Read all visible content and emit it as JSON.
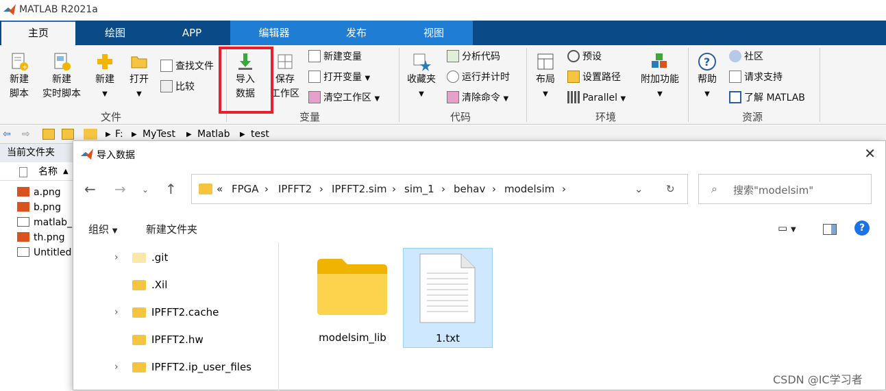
{
  "app": {
    "title": "MATLAB R2021a"
  },
  "tabs": [
    "主页",
    "绘图",
    "APP",
    "编辑器",
    "发布",
    "视图"
  ],
  "ribbon": {
    "file": {
      "new_script": "新建\n脚本",
      "new_live_script": "新建\n实时脚本",
      "new": "新建",
      "open": "打开",
      "find_files": "查找文件",
      "compare": "比较",
      "group_label": "文件"
    },
    "variable": {
      "import_data": "导入\n数据",
      "save_workspace": "保存\n工作区",
      "new_variable": "新建变量",
      "open_variable": "打开变量",
      "clear_workspace": "清空工作区",
      "group_label": "变量"
    },
    "code": {
      "favorites": "收藏夹",
      "analyze_code": "分析代码",
      "run_and_time": "运行并计时",
      "clear_commands": "清除命令",
      "group_label": "代码"
    },
    "environment": {
      "layout": "布局",
      "preferences": "预设",
      "set_path": "设置路径",
      "parallel": "Parallel",
      "addons": "附加功能",
      "group_label": "环境"
    },
    "resources": {
      "help": "帮助",
      "community": "社区",
      "request_support": "请求支持",
      "learn_matlab": "了解 MATLAB",
      "group_label": "资源"
    }
  },
  "path": [
    "F:",
    "MyTest",
    "Matlab",
    "test"
  ],
  "current_folder": {
    "title": "当前文件夹",
    "name_col": "名称",
    "files": [
      "a.png",
      "b.png",
      "matlab_",
      "th.png",
      "Untitled"
    ]
  },
  "dialog": {
    "title": "导入数据",
    "address": [
      "«",
      "FPGA",
      "IPFFT2",
      "IPFFT2.sim",
      "sim_1",
      "behav",
      "modelsim"
    ],
    "search_placeholder": "搜索\"modelsim\"",
    "organize": "组织",
    "new_folder": "新建文件夹",
    "tree": [
      ".git",
      ".Xil",
      "IPFFT2.cache",
      "IPFFT2.hw",
      "IPFFT2.ip_user_files"
    ],
    "files": [
      "modelsim_lib",
      "1.txt"
    ]
  },
  "watermark": "CSDN @IC学习者",
  "colors": {
    "tab_bar": "#0a4a86",
    "editor_tab": "#1f7dd4",
    "highlight": "#e8202a",
    "selection": "#cde8ff"
  }
}
